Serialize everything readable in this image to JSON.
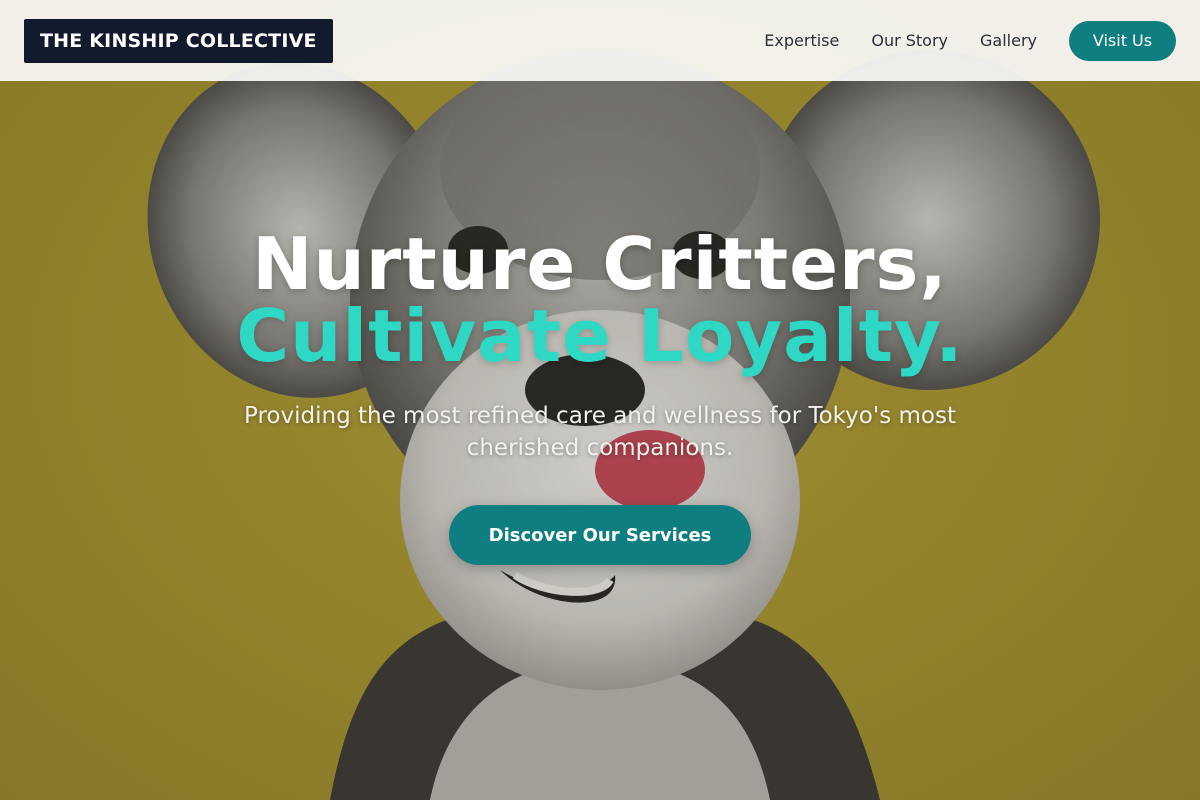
{
  "header": {
    "logo_text": "THE KINSHIP COLLECTIVE",
    "nav": [
      {
        "label": "Expertise"
      },
      {
        "label": "Our Story"
      },
      {
        "label": "Gallery"
      }
    ],
    "visit_label": "Visit Us"
  },
  "hero": {
    "headline_line1": "Nurture Critters,",
    "headline_line2": "Cultivate Loyalty.",
    "subtitle": "Providing the most refined care and wellness for Tokyo's most cherished companions.",
    "cta_label": "Discover Our Services",
    "background_image": "schnauzer-dog-photo"
  },
  "colors": {
    "brand_dark": "#121a2e",
    "accent_teal": "#0f7e80",
    "headline_accent": "#2ed8c4",
    "background_mustard": "#a8972f"
  }
}
